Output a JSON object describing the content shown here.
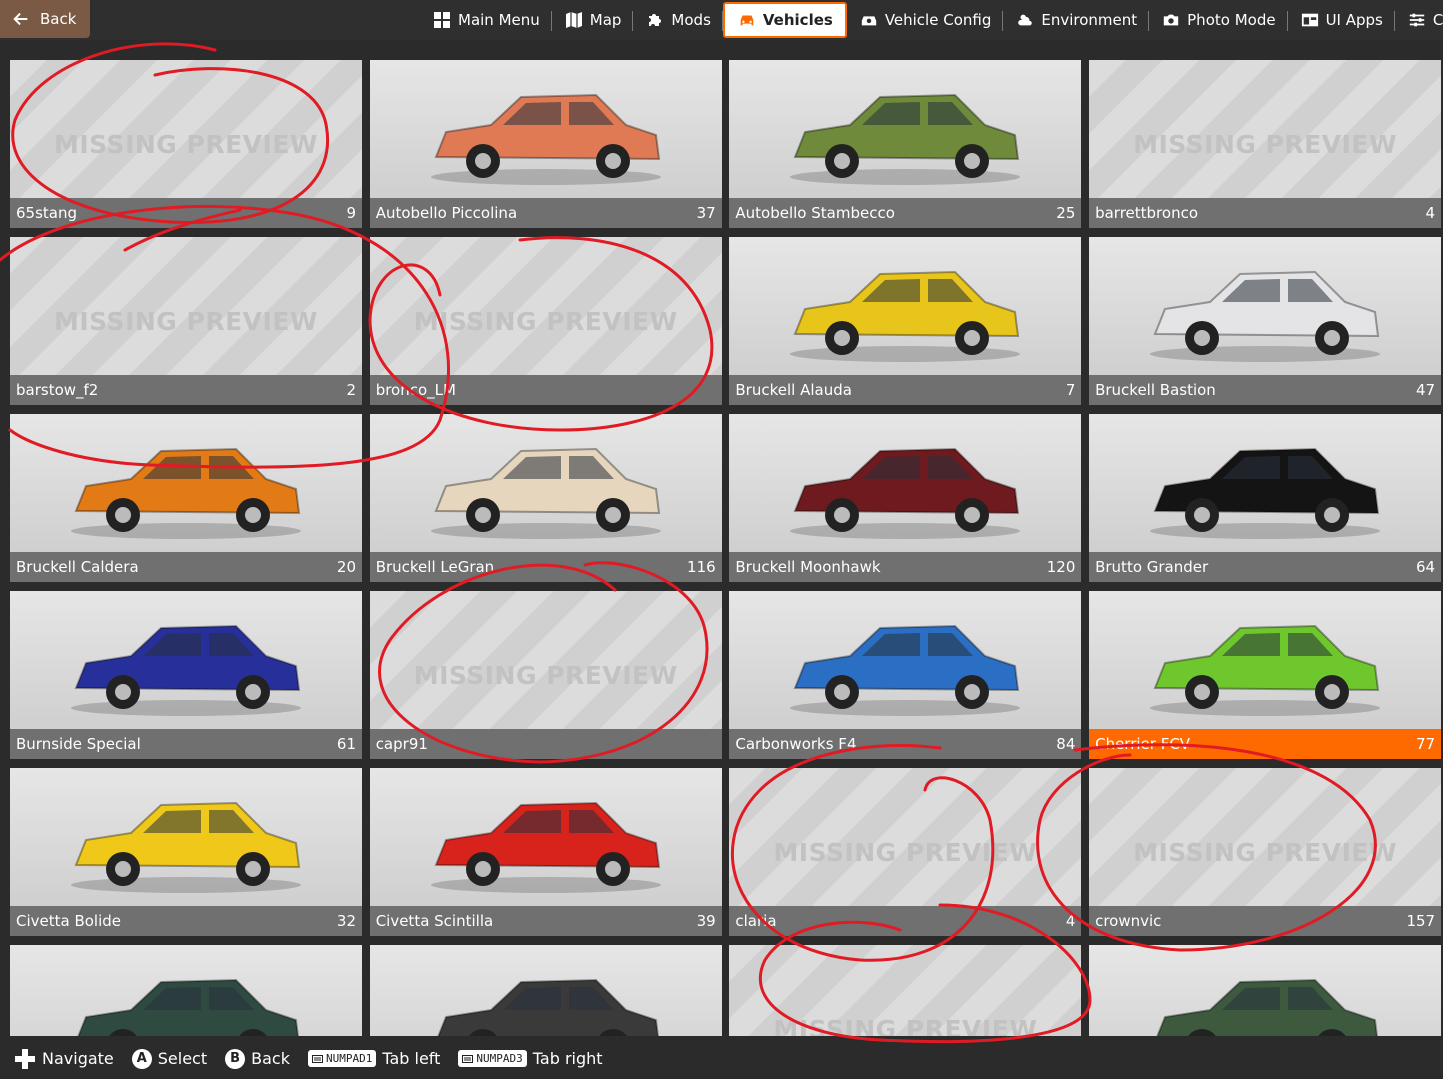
{
  "topbar": {
    "back_label": "Back",
    "tabs": [
      {
        "label": "Main Menu",
        "icon": "main-menu-icon"
      },
      {
        "label": "Map",
        "icon": "map-icon"
      },
      {
        "label": "Mods",
        "icon": "puzzle-icon"
      },
      {
        "label": "Vehicles",
        "icon": "car-icon",
        "active": true
      },
      {
        "label": "Vehicle Config",
        "icon": "vehicle-config-icon"
      },
      {
        "label": "Environment",
        "icon": "weather-icon"
      },
      {
        "label": "Photo Mode",
        "icon": "camera-icon"
      },
      {
        "label": "UI Apps",
        "icon": "apps-icon"
      },
      {
        "label": "C",
        "icon": "sliders-icon"
      }
    ]
  },
  "missing_preview_label": "MISSING PREVIEW",
  "vehicles": [
    {
      "name": "65stang",
      "count": "9",
      "missing": true
    },
    {
      "name": "Autobello Piccolina",
      "count": "37",
      "missing": false,
      "color": "#e07a55"
    },
    {
      "name": "Autobello Stambecco",
      "count": "25",
      "missing": false,
      "color": "#6e8a3a"
    },
    {
      "name": "barrettbronco",
      "count": "4",
      "missing": true
    },
    {
      "name": "barstow_f2",
      "count": "2",
      "missing": true
    },
    {
      "name": "bronco_LM",
      "count": "",
      "missing": true
    },
    {
      "name": "Bruckell Alauda",
      "count": "7",
      "missing": false,
      "color": "#e8c51a"
    },
    {
      "name": "Bruckell Bastion",
      "count": "47",
      "missing": false,
      "color": "#e4e4e6"
    },
    {
      "name": "Bruckell Caldera",
      "count": "20",
      "missing": false,
      "color": "#e27a16"
    },
    {
      "name": "Bruckell LeGran",
      "count": "116",
      "missing": false,
      "color": "#e6d6bd"
    },
    {
      "name": "Bruckell Moonhawk",
      "count": "120",
      "missing": false,
      "color": "#6e1a1e"
    },
    {
      "name": "Brutto Grander",
      "count": "64",
      "missing": false,
      "color": "#141414"
    },
    {
      "name": "Burnside Special",
      "count": "61",
      "missing": false,
      "color": "#27309a"
    },
    {
      "name": "capr91",
      "count": "",
      "missing": true
    },
    {
      "name": "Carbonworks F4",
      "count": "84",
      "missing": false,
      "color": "#2b6fc4"
    },
    {
      "name": "Cherrier FCV",
      "count": "77",
      "missing": false,
      "color": "#6ec72c",
      "selected": true
    },
    {
      "name": "Civetta Bolide",
      "count": "32",
      "missing": false,
      "color": "#f0c81a"
    },
    {
      "name": "Civetta Scintilla",
      "count": "39",
      "missing": false,
      "color": "#d8231c"
    },
    {
      "name": "claria",
      "count": "4",
      "missing": true
    },
    {
      "name": "crownvic",
      "count": "157",
      "missing": true
    },
    {
      "name": "",
      "count": "",
      "missing": false,
      "color": "#2f4a40"
    },
    {
      "name": "",
      "count": "",
      "missing": false,
      "color": "#3a3a3a"
    },
    {
      "name": "",
      "count": "",
      "missing": true
    },
    {
      "name": "",
      "count": "",
      "missing": false,
      "color": "#3d5a3f"
    }
  ],
  "bottombar": {
    "navigate": "Navigate",
    "select_key": "A",
    "select": "Select",
    "back_key": "B",
    "back": "Back",
    "tab_left_key": "NUMPAD1",
    "tab_left": "Tab left",
    "tab_right_key": "NUMPAD3",
    "tab_right": "Tab right"
  }
}
